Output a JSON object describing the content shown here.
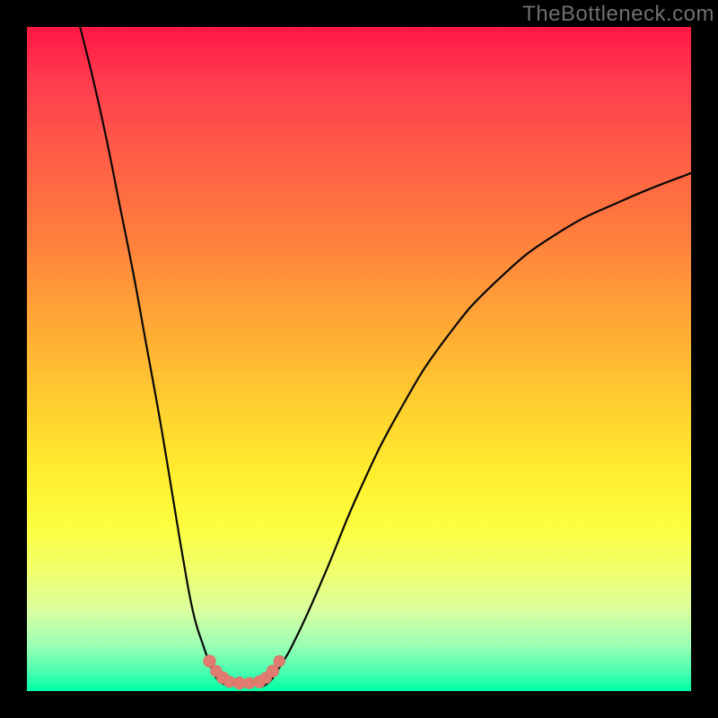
{
  "watermark": "TheBottleneck.com",
  "colors": {
    "frame_bg": "#000000",
    "gradient_top": "#ff1744",
    "gradient_mid": "#ffd22f",
    "gradient_bottom": "#00ffa6",
    "curve_stroke": "#080808",
    "marker_fill": "#e07b70"
  },
  "chart_data": {
    "type": "line",
    "title": "",
    "xlabel": "",
    "ylabel": "",
    "xlim": [
      0,
      100
    ],
    "ylim": [
      0,
      100
    ],
    "note": "x/y in percent of plot area; y=100 at top, y=0 at bottom. V-shaped bottleneck curve.",
    "series": [
      {
        "name": "left-arm",
        "x": [
          8,
          10,
          12,
          14,
          16,
          18,
          20,
          22,
          23.5,
          25,
          26.5,
          28,
          29,
          30
        ],
        "y": [
          100,
          92,
          83,
          73,
          63,
          52,
          41,
          29,
          20,
          12,
          7,
          3,
          1.5,
          1
        ]
      },
      {
        "name": "valley-floor",
        "x": [
          30,
          31.5,
          33,
          34.5,
          36
        ],
        "y": [
          1,
          0.9,
          0.9,
          0.9,
          1
        ]
      },
      {
        "name": "right-arm",
        "x": [
          36,
          38,
          41,
          45,
          50,
          56,
          63,
          71,
          80,
          90,
          100
        ],
        "y": [
          1,
          3.5,
          9,
          18,
          30,
          42,
          53,
          62,
          69,
          74,
          78
        ]
      }
    ],
    "markers": {
      "name": "sample-points",
      "x": [
        27.5,
        28.5,
        29.5,
        30.5,
        32,
        33.5,
        35,
        36,
        37,
        38
      ],
      "y": [
        4.5,
        3,
        2,
        1.4,
        1.2,
        1.2,
        1.4,
        2,
        3,
        4.5
      ]
    }
  }
}
